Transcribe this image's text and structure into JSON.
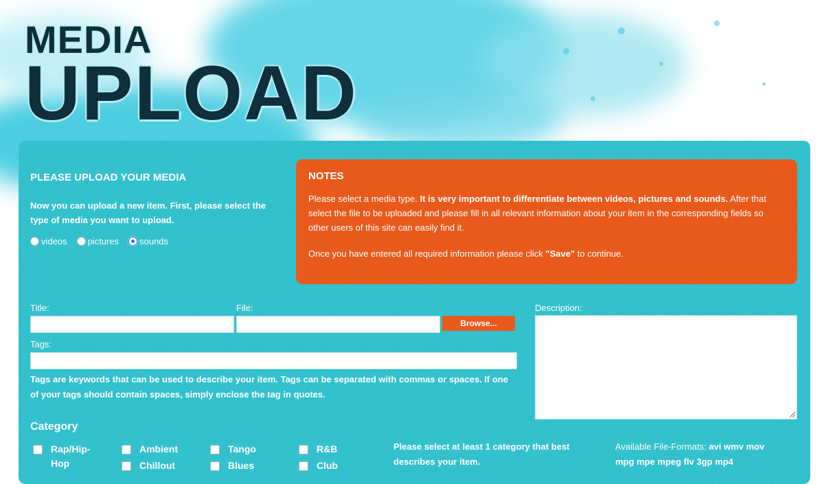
{
  "logo": {
    "line1": "MEDIA",
    "line2": "UPLOAD"
  },
  "upload": {
    "heading": "PLEASE UPLOAD YOUR MEDIA",
    "intro": "Now you can upload a new item. First, please select the type of media you want to upload.",
    "media_types": [
      {
        "label": "videos",
        "selected": false
      },
      {
        "label": "pictures",
        "selected": false
      },
      {
        "label": "sounds",
        "selected": true
      }
    ]
  },
  "notes": {
    "title": "NOTES",
    "p1_a": "Please select a media type. ",
    "p1_b": "It is very important to differentiate between videos, pictures and sounds.",
    "p1_c": " After that select the file to be uploaded and please fill in all relevant information about your item in the corresponding fields so other users of this site can easily find it.",
    "p2_a": "Once you have entered all required information please click ",
    "p2_b": "\"Save\"",
    "p2_c": " to continue."
  },
  "form": {
    "title_label": "Title:",
    "title_value": "",
    "file_label": "File:",
    "file_value": "",
    "browse_label": "Browse...",
    "tags_label": "Tags:",
    "tags_value": "",
    "tags_hint": "Tags are keywords that can be used to describe your item. Tags can be separated with commas or spaces. If one of your tags should contain spaces, simply enclose the tag in quotes.",
    "description_label": "Description:",
    "description_value": ""
  },
  "category": {
    "title": "Category",
    "items": [
      "Rap/Hip-Hop",
      "Ambient",
      "Tango",
      "R&B",
      "Chillout",
      "Blues",
      "Club"
    ],
    "select_note": "Please select at least 1 category that best describes your item.",
    "formats_prefix": "Available File-Formats: ",
    "formats_list": "avi wmv mov mpg mpe mpeg flv 3gp mp4"
  },
  "colors": {
    "panel": "#30c0cc",
    "notes": "#e85a1c",
    "logo": "#0f2f3a"
  }
}
